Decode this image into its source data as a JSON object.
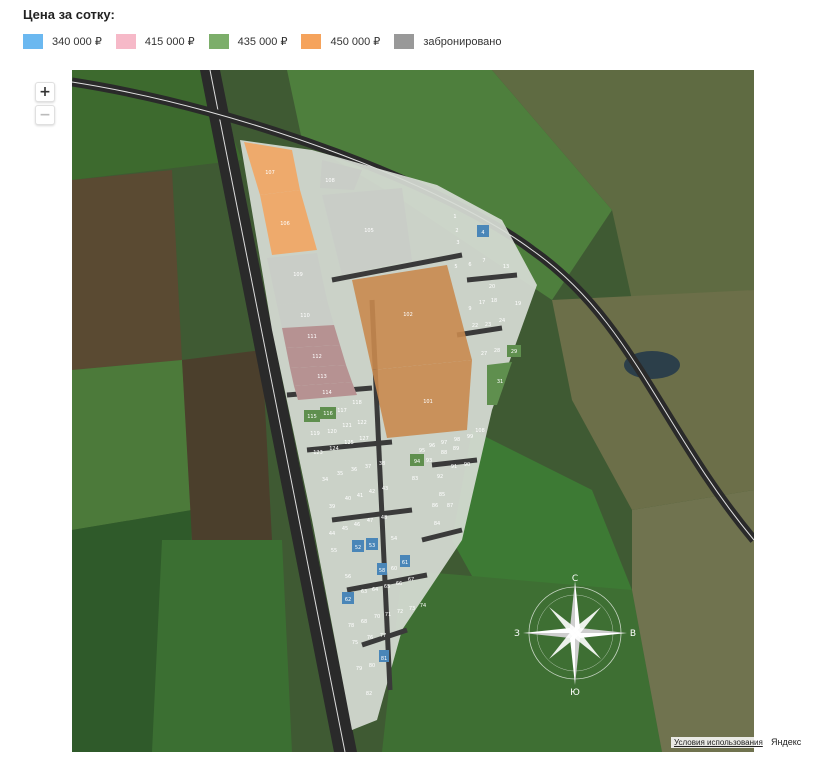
{
  "header": {
    "title": "Цена за сотку:"
  },
  "legend": [
    {
      "label": "340 000 ₽",
      "color": "#6bb8f0"
    },
    {
      "label": "415 000 ₽",
      "color": "#f6b9c8"
    },
    {
      "label": "435 000 ₽",
      "color": "#7cae6a"
    },
    {
      "label": "450 000 ₽",
      "color": "#f5a35c"
    },
    {
      "label": "забронировано",
      "color": "#999999"
    }
  ],
  "zoom": {
    "in_icon": "plus-icon",
    "out_icon": "minus-icon",
    "in": "+",
    "out": "−"
  },
  "map": {
    "plots": [
      {
        "n": "107",
        "s": "orange"
      },
      {
        "n": "106",
        "s": "orange"
      },
      {
        "n": "108",
        "s": "gray"
      },
      {
        "n": "105",
        "s": "gray"
      },
      {
        "n": "109",
        "s": "gray"
      },
      {
        "n": "110",
        "s": "gray"
      },
      {
        "n": "111",
        "s": "pink"
      },
      {
        "n": "112",
        "s": "pink"
      },
      {
        "n": "113",
        "s": "pink"
      },
      {
        "n": "114",
        "s": "pink"
      },
      {
        "n": "102",
        "s": "orange"
      },
      {
        "n": "101",
        "s": "orange"
      },
      {
        "n": "1",
        "s": "gray"
      },
      {
        "n": "2",
        "s": "gray"
      },
      {
        "n": "3",
        "s": "gray"
      },
      {
        "n": "4",
        "s": "blue"
      },
      {
        "n": "5",
        "s": "gray"
      },
      {
        "n": "6",
        "s": "gray"
      },
      {
        "n": "7",
        "s": "gray"
      },
      {
        "n": "13",
        "s": "gray"
      },
      {
        "n": "9",
        "s": "gray"
      },
      {
        "n": "17",
        "s": "gray"
      },
      {
        "n": "18",
        "s": "gray"
      },
      {
        "n": "19",
        "s": "gray"
      },
      {
        "n": "20",
        "s": "gray"
      },
      {
        "n": "22",
        "s": "gray"
      },
      {
        "n": "23",
        "s": "gray"
      },
      {
        "n": "24",
        "s": "gray"
      },
      {
        "n": "27",
        "s": "gray"
      },
      {
        "n": "28",
        "s": "gray"
      },
      {
        "n": "29",
        "s": "green"
      },
      {
        "n": "31",
        "s": "green"
      },
      {
        "n": "115",
        "s": "green"
      },
      {
        "n": "116",
        "s": "green"
      },
      {
        "n": "117",
        "s": "gray"
      },
      {
        "n": "118",
        "s": "gray"
      },
      {
        "n": "119",
        "s": "gray"
      },
      {
        "n": "120",
        "s": "gray"
      },
      {
        "n": "121",
        "s": "green"
      },
      {
        "n": "122",
        "s": "green"
      },
      {
        "n": "123",
        "s": "green"
      },
      {
        "n": "124",
        "s": "green"
      },
      {
        "n": "125",
        "s": "gray"
      },
      {
        "n": "127",
        "s": "gray"
      },
      {
        "n": "108",
        "s": "gray"
      },
      {
        "n": "99",
        "s": "gray"
      },
      {
        "n": "98",
        "s": "gray"
      },
      {
        "n": "97",
        "s": "gray"
      },
      {
        "n": "96",
        "s": "gray"
      },
      {
        "n": "95",
        "s": "gray"
      },
      {
        "n": "94",
        "s": "green"
      },
      {
        "n": "93",
        "s": "gray"
      },
      {
        "n": "92",
        "s": "gray"
      },
      {
        "n": "91",
        "s": "gray"
      },
      {
        "n": "90",
        "s": "gray"
      },
      {
        "n": "89",
        "s": "gray"
      },
      {
        "n": "88",
        "s": "gray"
      },
      {
        "n": "87",
        "s": "gray"
      },
      {
        "n": "86",
        "s": "gray"
      },
      {
        "n": "85",
        "s": "gray"
      },
      {
        "n": "84",
        "s": "gray"
      },
      {
        "n": "83",
        "s": "gray"
      },
      {
        "n": "34",
        "s": "gray"
      },
      {
        "n": "35",
        "s": "gray"
      },
      {
        "n": "36",
        "s": "gray"
      },
      {
        "n": "37",
        "s": "gray"
      },
      {
        "n": "38",
        "s": "gray"
      },
      {
        "n": "39",
        "s": "gray"
      },
      {
        "n": "40",
        "s": "gray"
      },
      {
        "n": "41",
        "s": "gray"
      },
      {
        "n": "42",
        "s": "gray"
      },
      {
        "n": "43",
        "s": "gray"
      },
      {
        "n": "44",
        "s": "gray"
      },
      {
        "n": "45",
        "s": "gray"
      },
      {
        "n": "46",
        "s": "gray"
      },
      {
        "n": "47",
        "s": "gray"
      },
      {
        "n": "48",
        "s": "gray"
      },
      {
        "n": "52",
        "s": "blue"
      },
      {
        "n": "53",
        "s": "blue"
      },
      {
        "n": "54",
        "s": "gray"
      },
      {
        "n": "55",
        "s": "gray"
      },
      {
        "n": "56",
        "s": "gray"
      },
      {
        "n": "58",
        "s": "blue"
      },
      {
        "n": "60",
        "s": "gray"
      },
      {
        "n": "61",
        "s": "blue"
      },
      {
        "n": "62",
        "s": "blue"
      },
      {
        "n": "63",
        "s": "gray"
      },
      {
        "n": "64",
        "s": "gray"
      },
      {
        "n": "65",
        "s": "gray"
      },
      {
        "n": "66",
        "s": "gray"
      },
      {
        "n": "67",
        "s": "gray"
      },
      {
        "n": "68",
        "s": "gray"
      },
      {
        "n": "70",
        "s": "gray"
      },
      {
        "n": "71",
        "s": "gray"
      },
      {
        "n": "72",
        "s": "gray"
      },
      {
        "n": "73",
        "s": "gray"
      },
      {
        "n": "74",
        "s": "gray"
      },
      {
        "n": "75",
        "s": "gray"
      },
      {
        "n": "76",
        "s": "gray"
      },
      {
        "n": "77",
        "s": "gray"
      },
      {
        "n": "78",
        "s": "gray"
      },
      {
        "n": "79",
        "s": "gray"
      },
      {
        "n": "80",
        "s": "gray"
      },
      {
        "n": "81",
        "s": "blue"
      },
      {
        "n": "82",
        "s": "gray"
      }
    ],
    "compass": {
      "n": "С",
      "s": "Ю",
      "w": "З",
      "e": "В"
    }
  },
  "footer": {
    "terms": "Условия использования",
    "brand": "Яндекс"
  }
}
